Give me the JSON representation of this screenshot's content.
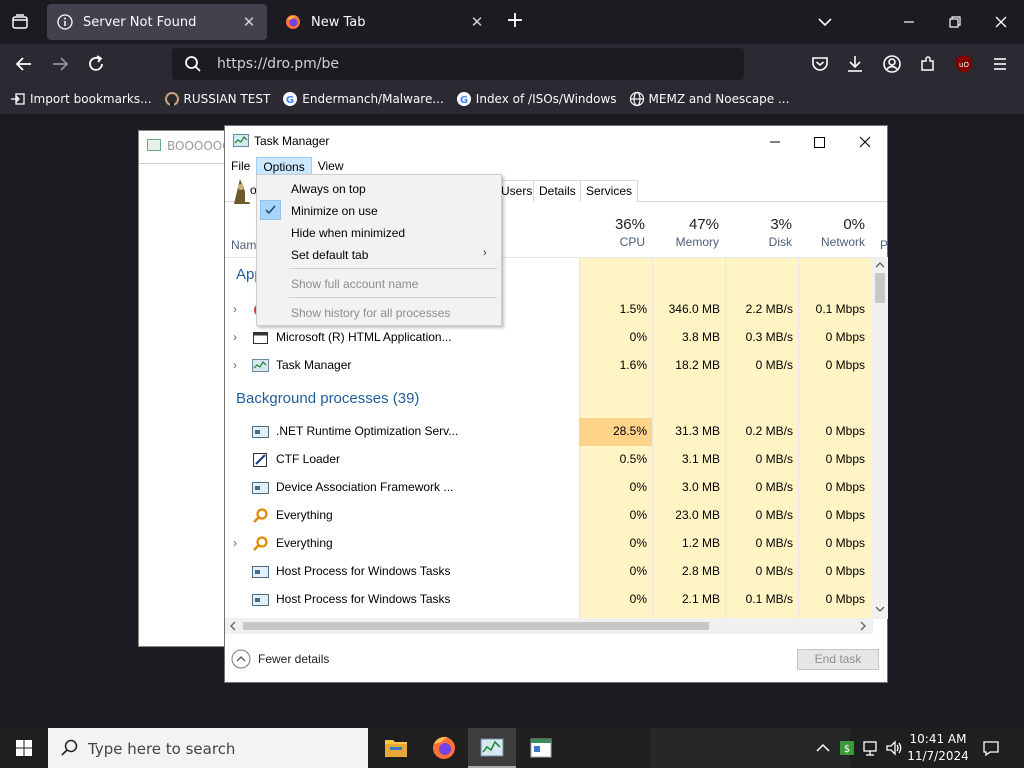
{
  "browser": {
    "tabs": [
      {
        "title": "Server Not Found"
      },
      {
        "title": "New Tab"
      }
    ],
    "url": "https://dro.pm/be",
    "bookmarks": [
      {
        "label": "Import bookmarks..."
      },
      {
        "label": "RUSSIAN TEST"
      },
      {
        "label": "Endermanch/Malware..."
      },
      {
        "label": "Index of /ISOs/Windows"
      },
      {
        "label": "MEMZ and Noescape ..."
      }
    ],
    "close_glyph": "✕",
    "new_tab_glyph": "+"
  },
  "bg_window": {
    "title": "BOOOOOO"
  },
  "task_manager": {
    "title": "Task Manager",
    "menu": [
      "File",
      "Options",
      "View"
    ],
    "tabs_visible": [
      "Users",
      "Details",
      "Services"
    ],
    "tab_partial": "oc",
    "columns": {
      "name": "Nam",
      "cpu": {
        "percent": "36%",
        "label": "CPU"
      },
      "memory": {
        "percent": "47%",
        "label": "Memory"
      },
      "disk": {
        "percent": "3%",
        "label": "Disk"
      },
      "network": {
        "percent": "0%",
        "label": "Network"
      },
      "next": "P"
    },
    "apps_group_partial": "App",
    "background_group": "Background processes (39)",
    "rows": [
      {
        "name": "",
        "cpu": "1.5%",
        "memory": "346.0 MB",
        "disk": "2.2 MB/s",
        "network": "0.1 Mbps",
        "expander": true
      },
      {
        "name": "Microsoft (R) HTML Application...",
        "cpu": "0%",
        "memory": "3.8 MB",
        "disk": "0.3 MB/s",
        "network": "0 Mbps",
        "expander": true
      },
      {
        "name": "Task Manager",
        "cpu": "1.6%",
        "memory": "18.2 MB",
        "disk": "0 MB/s",
        "network": "0 Mbps",
        "expander": true
      },
      {
        "name": ".NET Runtime Optimization Serv...",
        "cpu": "28.5%",
        "memory": "31.3 MB",
        "disk": "0.2 MB/s",
        "network": "0 Mbps",
        "expander": false
      },
      {
        "name": "CTF Loader",
        "cpu": "0.5%",
        "memory": "3.1 MB",
        "disk": "0 MB/s",
        "network": "0 Mbps",
        "expander": false
      },
      {
        "name": "Device Association Framework ...",
        "cpu": "0%",
        "memory": "3.0 MB",
        "disk": "0 MB/s",
        "network": "0 Mbps",
        "expander": false
      },
      {
        "name": "Everything",
        "cpu": "0%",
        "memory": "23.0 MB",
        "disk": "0 MB/s",
        "network": "0 Mbps",
        "expander": false
      },
      {
        "name": "Everything",
        "cpu": "0%",
        "memory": "1.2 MB",
        "disk": "0 MB/s",
        "network": "0 Mbps",
        "expander": true
      },
      {
        "name": "Host Process for Windows Tasks",
        "cpu": "0%",
        "memory": "2.8 MB",
        "disk": "0 MB/s",
        "network": "0 Mbps",
        "expander": false
      },
      {
        "name": "Host Process for Windows Tasks",
        "cpu": "0%",
        "memory": "2.1 MB",
        "disk": "0.1 MB/s",
        "network": "0 Mbps",
        "expander": false
      }
    ],
    "options_menu": [
      {
        "label": "Always on top",
        "checked": false,
        "disabled": false
      },
      {
        "label": "Minimize on use",
        "checked": true,
        "disabled": false
      },
      {
        "label": "Hide when minimized",
        "checked": false,
        "disabled": false
      },
      {
        "label": "Set default tab",
        "checked": false,
        "disabled": false,
        "submenu_arrow": "›"
      },
      {
        "label": "Show full account name",
        "checked": false,
        "disabled": true
      },
      {
        "label": "Show history for all processes",
        "checked": false,
        "disabled": true
      }
    ],
    "fewer_details": "Fewer details",
    "end_task": "End task"
  },
  "taskbar": {
    "search_placeholder": "Type here to search",
    "time": "10:41 AM",
    "date": "11/7/2024"
  },
  "colors": {
    "accent_highlight": "#fff4c4",
    "cpu_hot": "#ffd38a",
    "group_blue": "#1e5f9d"
  }
}
